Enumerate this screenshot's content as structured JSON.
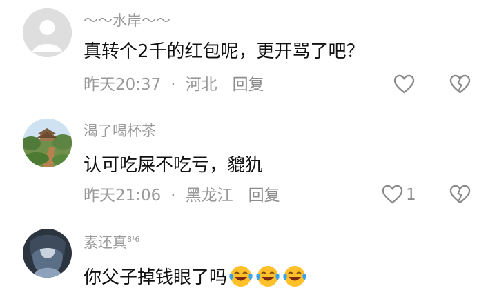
{
  "comments": [
    {
      "username": "～～水岸～～",
      "level": "",
      "content": "真转个2千的红包呢，更开骂了吧？",
      "time": "昨天20:37",
      "location": "河北",
      "reply_label": "回复",
      "likes": ""
    },
    {
      "username": "渴了喝杯茶",
      "level": "",
      "content": "认可吃屎不吃亏，貔犰",
      "time": "昨天21:06",
      "location": "黑龙江",
      "reply_label": "回复",
      "likes": "1"
    },
    {
      "username": "素还真",
      "level": "8¹6",
      "content": "你父子掉钱眼了吗",
      "emoji_count": 3
    }
  ],
  "separator": "·",
  "colors": {
    "text": "#111111",
    "secondary": "#9a9a9a",
    "icon": "#8a8a8a",
    "emoji_yellow": "#ffc02a",
    "emoji_tears": "#3aa3f0"
  }
}
